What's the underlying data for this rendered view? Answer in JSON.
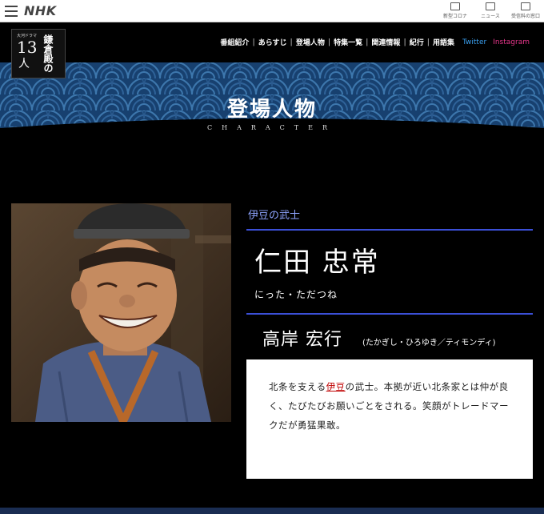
{
  "nhk_bar": {
    "logo": "NHK",
    "links": [
      {
        "label": "新型コロナ",
        "icon": "document-icon"
      },
      {
        "label": "ニュース",
        "icon": "news-icon"
      },
      {
        "label": "受信料の窓口",
        "icon": "reception-icon"
      }
    ]
  },
  "show": {
    "logo": {
      "small": "大河ドラマ",
      "number": "13",
      "person": "人",
      "vertical_title": "鎌倉殿の"
    },
    "nav": [
      "番組紹介",
      "あらすじ",
      "登場人物",
      "特集一覧",
      "関連情報",
      "紀行",
      "用語集"
    ],
    "twitter": "Twitter",
    "instagram": "Instagram"
  },
  "banner": {
    "title": "登場人物",
    "subtitle": "CHARACTER"
  },
  "character": {
    "role": "伊豆の武士",
    "name": "仁田 忠常",
    "reading": "にった・ただつね",
    "actor": "高岸 宏行",
    "actor_reading": "(たかぎし・ひろゆき／ティモンディ)",
    "description_pre": "北条を支える",
    "description_link": "伊豆",
    "description_post": "の武士。本拠が近い北条家とは仲が良く、たびたびお願いごとをされる。笑顔がトレードマークだが勇猛果敢。"
  },
  "colors": {
    "accent_blue": "#3b4fd6",
    "role_text": "#8ea4ff",
    "twitter": "#3aa0f0",
    "instagram": "#e6368b",
    "banner_wave": "#1d4f86"
  }
}
